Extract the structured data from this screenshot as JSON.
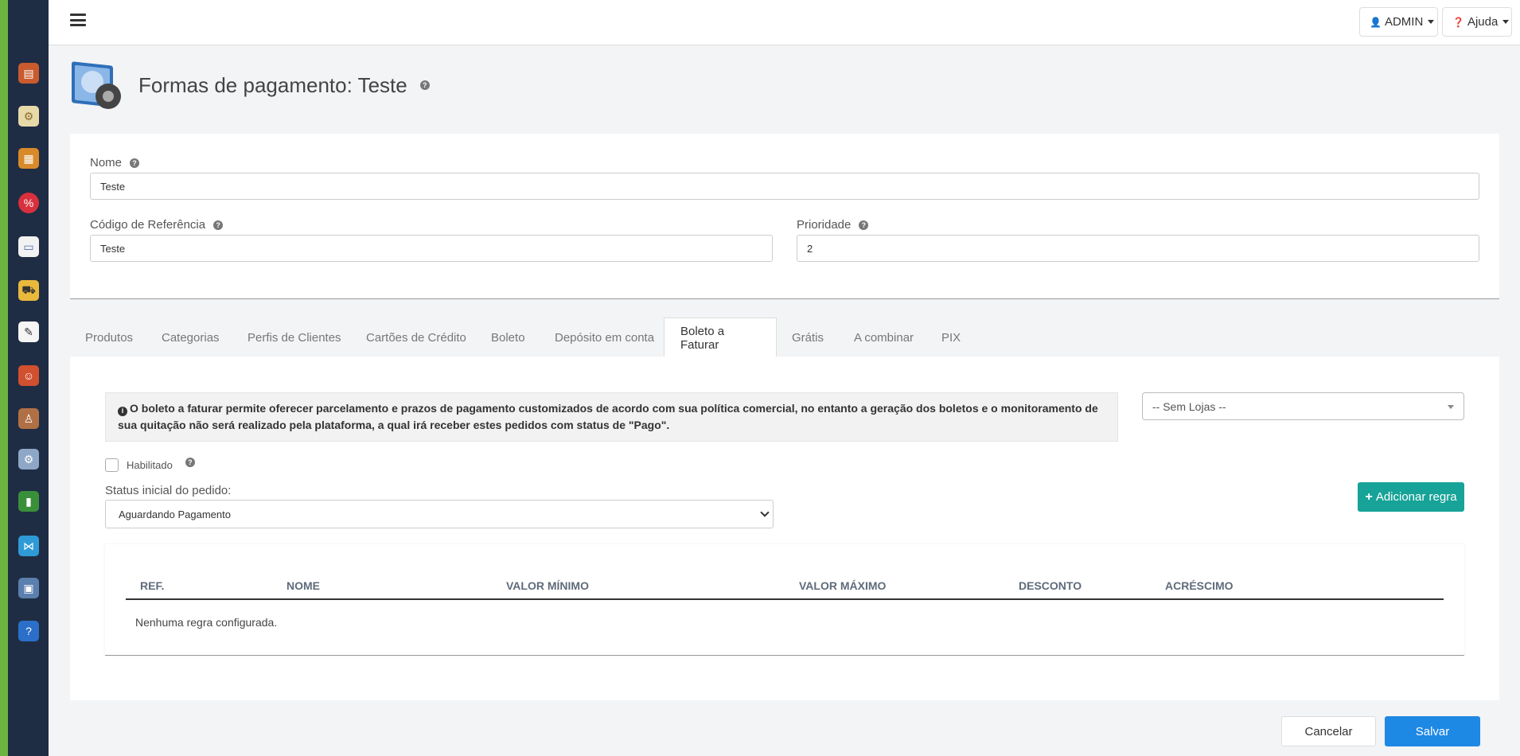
{
  "topbar": {
    "user_label": "ADMIN",
    "help_label": "Ajuda"
  },
  "header": {
    "title": "Formas de pagamento: Teste"
  },
  "form": {
    "nome_label": "Nome",
    "nome_value": "Teste",
    "codigo_label": "Código de Referência",
    "codigo_value": "Teste",
    "prioridade_label": "Prioridade",
    "prioridade_value": "2"
  },
  "tabs": [
    {
      "label": "Produtos"
    },
    {
      "label": "Categorias"
    },
    {
      "label": "Perfis de Clientes"
    },
    {
      "label": "Cartões de Crédito"
    },
    {
      "label": "Boleto"
    },
    {
      "label": "Depósito em conta"
    },
    {
      "label": "Boleto a Faturar"
    },
    {
      "label": "Grátis"
    },
    {
      "label": "A combinar"
    },
    {
      "label": "PIX"
    }
  ],
  "active_tab": "Boleto a Faturar",
  "boleto": {
    "alert_text": "O boleto a faturar permite oferecer parcelamento e prazos de pagamento customizados de acordo com sua política comercial, no entanto a geração dos boletos e o monitoramento de sua quitação não será realizado pela plataforma, a qual irá receber estes pedidos com status de \"Pago\".",
    "store_select": "-- Sem Lojas --",
    "enabled_label": "Habilitado",
    "status_label": "Status inicial do pedido:",
    "status_value": "Aguardando Pagamento",
    "add_rule_label": "Adicionar regra",
    "table": {
      "headers": [
        "REF.",
        "NOME",
        "VALOR MÍNIMO",
        "VALOR MÁXIMO",
        "DESCONTO",
        "ACRÉSCIMO"
      ],
      "empty_text": "Nenhuma regra configurada."
    }
  },
  "footer": {
    "cancel_label": "Cancelar",
    "save_label": "Salvar"
  },
  "colors": {
    "sidebar": "#1f2d44",
    "edge": "#6cb33f",
    "primary": "#1e88e5",
    "teal": "#17a398"
  },
  "sidebar_icons": [
    "database-icon",
    "image-settings-icon",
    "boxes-icon",
    "discount-icon",
    "card-icon",
    "truck-icon",
    "document-icon",
    "users-icon",
    "user-icon",
    "database-settings-icon",
    "chart-icon",
    "share-icon",
    "monitor-settings-icon",
    "help-book-icon"
  ]
}
